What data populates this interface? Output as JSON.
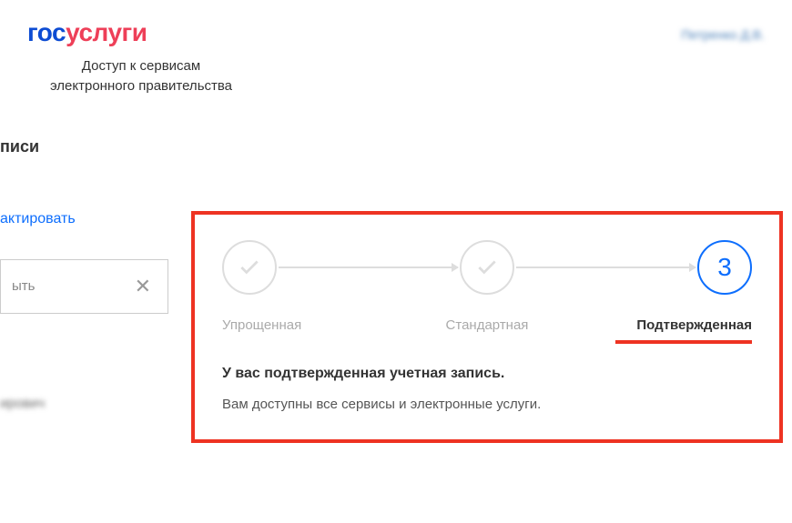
{
  "logo": {
    "part1": "гос",
    "part2": "услуги"
  },
  "tagline_line1": "Доступ к сервисам",
  "tagline_line2": "электронного правительства",
  "user_display": "Петренко Д.В.",
  "section_title_fragment": "писи",
  "left": {
    "edit_link": "актировать",
    "input_fragment": "ыть",
    "blurred_text": "ирович"
  },
  "steps": {
    "step1_label": "Упрощенная",
    "step2_label": "Стандартная",
    "step3_label": "Подтвержденная",
    "step3_num": "3"
  },
  "status": {
    "title": "У вас подтвержденная учетная запись.",
    "desc": "Вам доступны все сервисы и электронные услуги."
  }
}
